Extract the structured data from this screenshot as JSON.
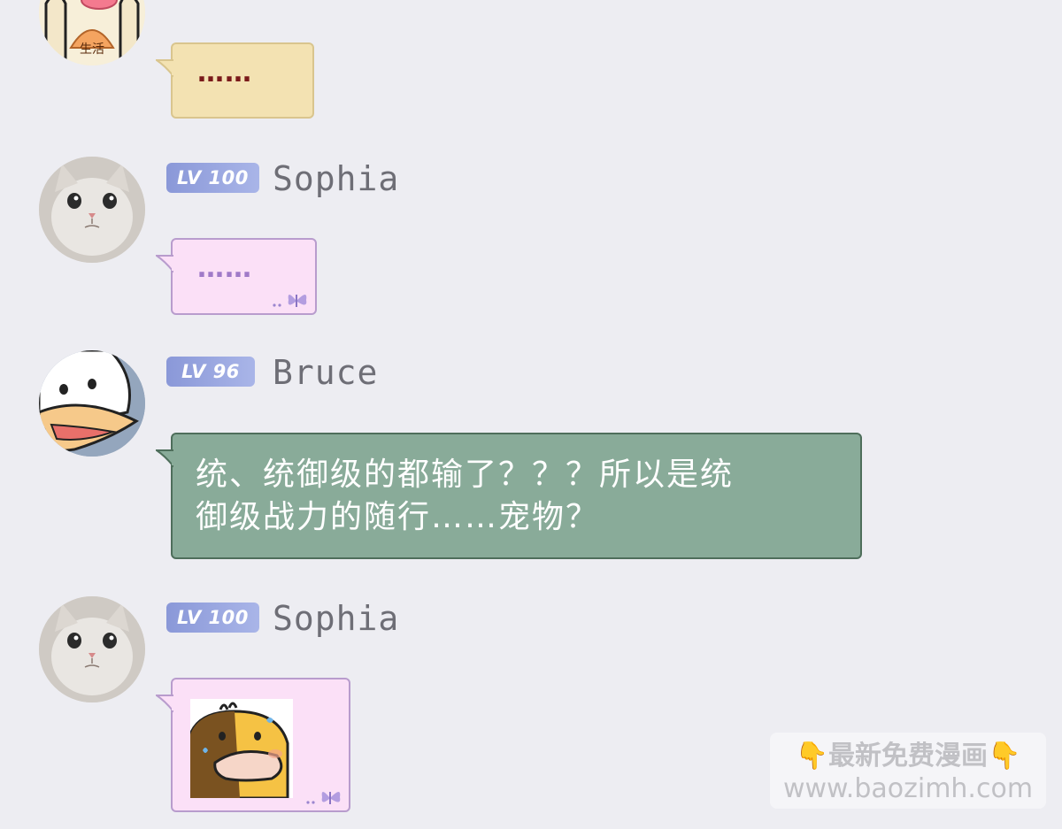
{
  "messages": [
    {
      "avatar": "avatar-life-icon",
      "avatar_text": "生活",
      "bubble_text": "……",
      "bubble_color": "#f3e2b2",
      "text_color": "#7a1a1a"
    },
    {
      "avatar": "cat-avatar-icon",
      "level": "LV 100",
      "username": "Sophia",
      "bubble_text": "……",
      "bubble_color": "#fbe0f7",
      "text_color": "#a07ac8",
      "decoration": "butterfly-icon"
    },
    {
      "avatar": "duck-avatar-icon",
      "level": "LV 96",
      "username": "Bruce",
      "bubble_text_line1": "统、统御级的都输了？？？所以是统",
      "bubble_text_line2": "御级战力的随行……宠物？",
      "bubble_color": "#89ab99",
      "text_color": "#ffffff"
    },
    {
      "avatar": "cat-avatar-icon",
      "level": "LV 100",
      "username": "Sophia",
      "sticker": "nervous-duck-sticker-icon",
      "bubble_color": "#fbe0f7",
      "decoration": "butterfly-icon"
    }
  ],
  "watermark": {
    "line1": "最新免费漫画",
    "line2": "www.baozimh.com",
    "icon": "pointing-down-icon"
  }
}
